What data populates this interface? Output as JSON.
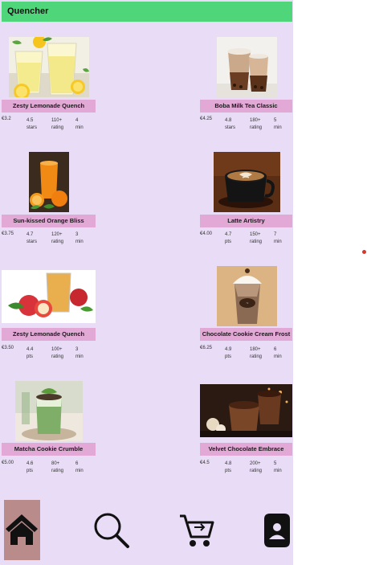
{
  "app": {
    "title": "Quencher"
  },
  "products": [
    {
      "name": "Zesty Lemonade Quench",
      "price": "€3.2",
      "rating": "4.5\nstars",
      "reviews": "110+\nrating",
      "time": "4 min",
      "image": "lemonade-glasses"
    },
    {
      "name": "Boba Milk Tea Classic",
      "price": "€4.25",
      "rating": "4.8\nstars",
      "reviews": "180+\nrating",
      "time": "5 min",
      "image": "boba-tea-cups"
    },
    {
      "name": "Sun-kissed Orange Bliss",
      "price": "€3.75",
      "rating": "4.7\nstars",
      "reviews": "120+\nrating",
      "time": "3 min",
      "image": "orange-juice"
    },
    {
      "name": "Latte Artistry",
      "price": "€4.00",
      "rating": "4.7 pts",
      "reviews": "150+\nrating",
      "time": "7 min",
      "image": "latte-cup"
    },
    {
      "name": "Zesty Lemonade Quench",
      "price": "€3.50",
      "rating": "4.4 pts",
      "reviews": "100+\nrating",
      "time": "3 min",
      "image": "apple-tea"
    },
    {
      "name": "Chocolate Cookie Cream Frost",
      "price": "€6.25",
      "rating": "4.9 pts",
      "reviews": "180+\nrating",
      "time": "6 min",
      "image": "frappe-cup"
    },
    {
      "name": "Matcha Cookie Crumble",
      "price": "€5.00",
      "rating": "4.6 pts",
      "reviews": "80+\nrating",
      "time": "6 min",
      "image": "matcha-drink"
    },
    {
      "name": "Velvet Chocolate Embrace",
      "price": "€4.5",
      "rating": "4.8 pts",
      "reviews": "200+\nrating",
      "time": "5 min",
      "image": "hot-chocolate"
    }
  ],
  "nav": {
    "items": [
      {
        "icon": "home-icon",
        "active": true
      },
      {
        "icon": "search-icon",
        "active": false
      },
      {
        "icon": "cart-icon",
        "active": false
      },
      {
        "icon": "profile-icon",
        "active": false
      }
    ]
  },
  "colors": {
    "header": "#4fd67a",
    "background": "#e8dcf6",
    "label": "#e2a9d6",
    "active_nav": "#b98b8b"
  }
}
